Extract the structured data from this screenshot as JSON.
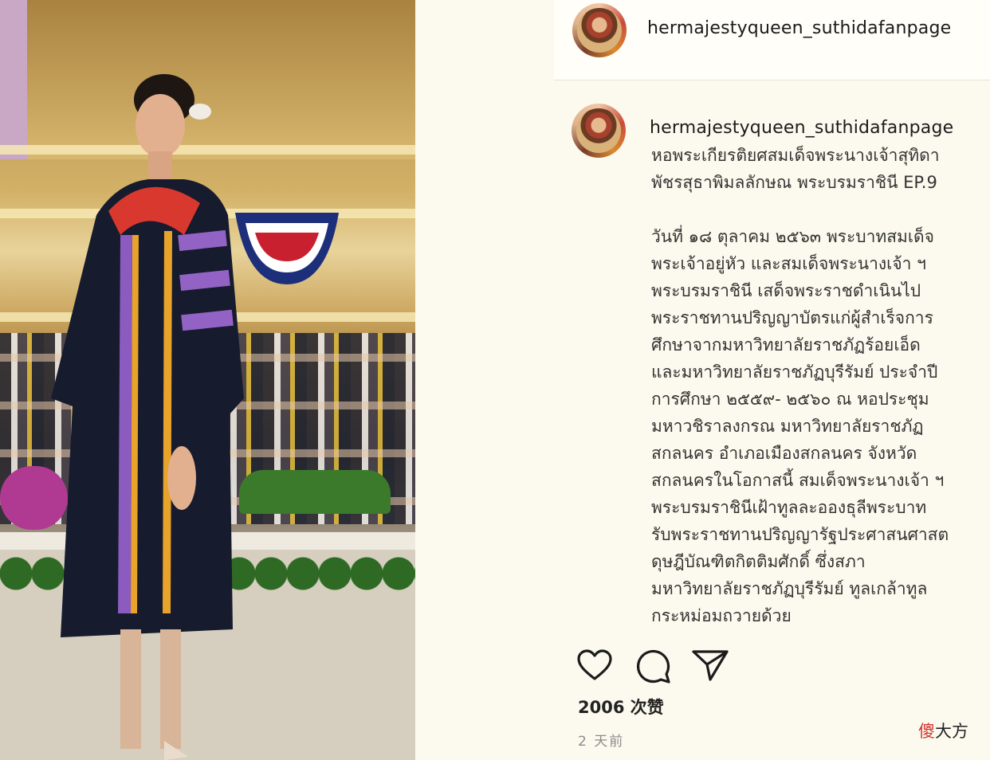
{
  "post": {
    "header_username": "hermajestyqueen_suthidafanpage",
    "caption_username": "hermajestyqueen_suthidafanpage",
    "caption_lines": [
      "หอพระเกียรติยศสมเด็จพระนางเจ้าสุทิดา",
      "พัชรสุธาพิมลลักษณ พระบรมราชินี EP.9",
      "",
      "วันที่ ๑๘ ตุลาคม ๒๕๖๓ พระบาทสมเด็จ",
      "พระเจ้าอยู่หัว และสมเด็จพระนางเจ้า ฯ",
      "พระบรมราชินี เสด็จพระราชดำเนินไป",
      "พระราชทานปริญญาบัตรแก่ผู้สำเร็จการ",
      "ศึกษาจากมหาวิทยาลัยราชภัฏร้อยเอ็ด",
      "และมหาวิทยาลัยราชภัฏบุรีรัมย์ ประจำปี",
      "การศึกษา ๒๕๕๙- ๒๕๖๐ ณ หอประชุม",
      "มหาวชิราลงกรณ มหาวิทยาลัยราชภัฏ",
      "สกลนคร อำเภอเมืองสกลนคร จังหวัด",
      "สกลนครในโอกาสนี้ สมเด็จพระนางเจ้า ฯ",
      "พระบรมราชินีเฝ้าทูลละอองธุลีพระบาท",
      "รับพระราชทานปริญญารัฐประศาสนศาสต",
      "ดุษฎีบัณฑิตกิตติมศักดิ์ ซึ่งสภา",
      "มหาวิทยาลัยราชภัฏบุรีรัมย์ ทูลเกล้าทูล",
      "กระหม่อมถวายด้วย"
    ],
    "caption_dot": ".",
    "likes": "2006 次赞",
    "time": "2 天前"
  },
  "icons": {
    "like": "heart-icon",
    "comment": "comment-icon",
    "share": "send-icon"
  },
  "watermark": {
    "red_char": "傻",
    "rest": "大方"
  },
  "colors": {
    "page_bg": "#fcfaee",
    "text": "#333333",
    "watermark_red": "#d0312d"
  }
}
